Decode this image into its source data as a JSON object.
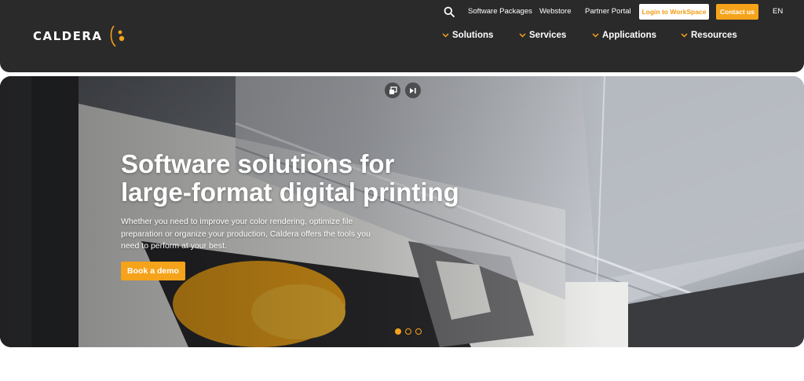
{
  "brand": {
    "name": "CALDERA",
    "accent": "#f5a31a"
  },
  "topbar": {
    "search_icon": "search-icon",
    "links": [
      "Software Packages",
      "Webstore",
      "Partner Portal"
    ],
    "login_label": "Login to WorkSpace",
    "contact_label": "Contact us",
    "language": "EN"
  },
  "nav": {
    "items": [
      "Solutions",
      "Services",
      "Applications",
      "Resources"
    ],
    "icon": "chevron-down-icon"
  },
  "hero": {
    "title_line1": "Software solutions for",
    "title_line2": "large-format digital printing",
    "subtitle": "Whether you need to improve your color rendering, optimize file preparation or organize your production, Caldera offers the tools you need to perform at your best.",
    "cta_label": "Book a demo",
    "video_controls": [
      "picture-in-picture-icon",
      "skip-forward-icon"
    ],
    "slides": {
      "count": 3,
      "active_index": 0
    }
  }
}
